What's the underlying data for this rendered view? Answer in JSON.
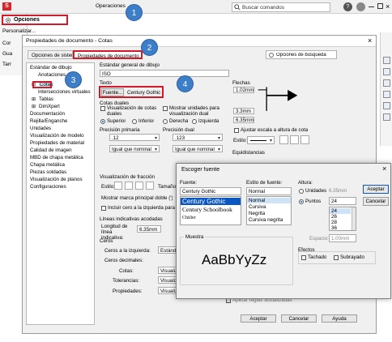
{
  "app": {
    "toolbar_label": "Operaciones",
    "search_placeholder": "Buscar comandos"
  },
  "menu": {
    "items": [
      "Opciones",
      "Personalizar...",
      "Cor",
      "Gua",
      "Tarr"
    ]
  },
  "dialog": {
    "title": "Propiedades de documento - Cotas",
    "tabs": [
      "Opciones de sistema",
      "Propiedades de documento"
    ],
    "search_label": "Opciones de búsqueda",
    "tree": [
      "Estándar de dibujo",
      "Anotaciones",
      "Cotas",
      "Intersecciones virtuales",
      "Tablas",
      "DimXpert",
      "Documentación",
      "Rejilla/Enganche",
      "Unidades",
      "Visualización de modelo",
      "Propiedades de material",
      "Calidad de imagen",
      "MBD de chapa metálica",
      "Chapa metálica",
      "Piezas soldadas",
      "Visualización de planos",
      "Configuraciones"
    ],
    "std_label": "Estándar general de dibujo",
    "std_value": "ISO",
    "texto_label": "Texto",
    "fuente_button": "Fuente...",
    "fuente_value": "Century Gothic",
    "flechas_label": "Flechas",
    "arrow_vals": [
      "1.02mm",
      "3.3mm",
      "6.35mm"
    ],
    "cotas_duales_label": "Cotas duales",
    "cb_vis_duales": "Visualización de cotas duales",
    "cb_mostrar_unidades": "Mostrar unidades para visualización dual",
    "pos_options": [
      "Superior",
      "Inferior",
      "Derecha",
      "Izquierda"
    ],
    "cb_ajustar": "Ajustar escala a altura de cota",
    "estilo_label": "Estilo:",
    "prec_primaria_label": "Precisión primaria",
    "prec_dual_label": "Precisión dual",
    "prec_primaria_val": ".12",
    "prec_dual_val": ".123",
    "igual_que": "Igual que nominal",
    "equidistancias_label": "Equidistancias",
    "vis_fraccion_label": "Visualización de fracción",
    "estilo2_label": "Estilo:",
    "tamano_label": "Tamaño de pil",
    "mostrar_marca": "Mostrar marca principal doble (')",
    "incluir_cero": "Incluir cero a la izquierda para val",
    "lineas_ind_label": "Líneas indicativas acodadas",
    "longitud_label": "Longitud de línea indicativa:",
    "longitud_val": "6.35mm",
    "ceros_label": "Ceros",
    "ceros_izq_label": "Ceros a la izquierda:",
    "ceros_izq_val": "Estándar",
    "ceros_dec_label": "Ceros decimales:",
    "cotas_label": "Cotas:",
    "tolerancias_label": "Tolerancias:",
    "propiedades_label": "Propiedades:",
    "visualizar_val": "Visualizar",
    "aplicar_reglas": "Aplicar reglas actualizadas",
    "buttons": [
      "Aceptar",
      "Cancelar",
      "Ayuda"
    ]
  },
  "font_dialog": {
    "title": "Escoger fuente",
    "fuente_label": "Fuente:",
    "fuente_value": "Century Gothic",
    "fuente_list": [
      "Century Gothic",
      "Century Schoolbook",
      "Chiller"
    ],
    "estilo_label": "Estilo de fuente:",
    "estilo_value": "Normal",
    "estilo_list": [
      "Normal",
      "Cursiva",
      "Negrita",
      "Cursiva negrita"
    ],
    "altura_label": "Altura:",
    "unidades_label": "Unidades",
    "unidades_val": "6.35mm",
    "puntos_label": "Puntos",
    "puntos_val": "24",
    "puntos_list": [
      "24",
      "26",
      "28",
      "36"
    ],
    "espacio_label": "Espacio:",
    "espacio_val": "1.00mm",
    "muestra_label": "Muestra",
    "sample": "AaBbYyZz",
    "efectos_label": "Efectos",
    "tachado": "Tachado",
    "subrayado": "Subrayado",
    "aceptar": "Aceptar",
    "cancelar": "Cancelar"
  },
  "callouts": [
    "1",
    "2",
    "3",
    "4"
  ],
  "colors": {
    "highlight_red": "#d11a2a",
    "callout_blue": "#3d7ec9",
    "selection_blue": "#0a57c2"
  }
}
